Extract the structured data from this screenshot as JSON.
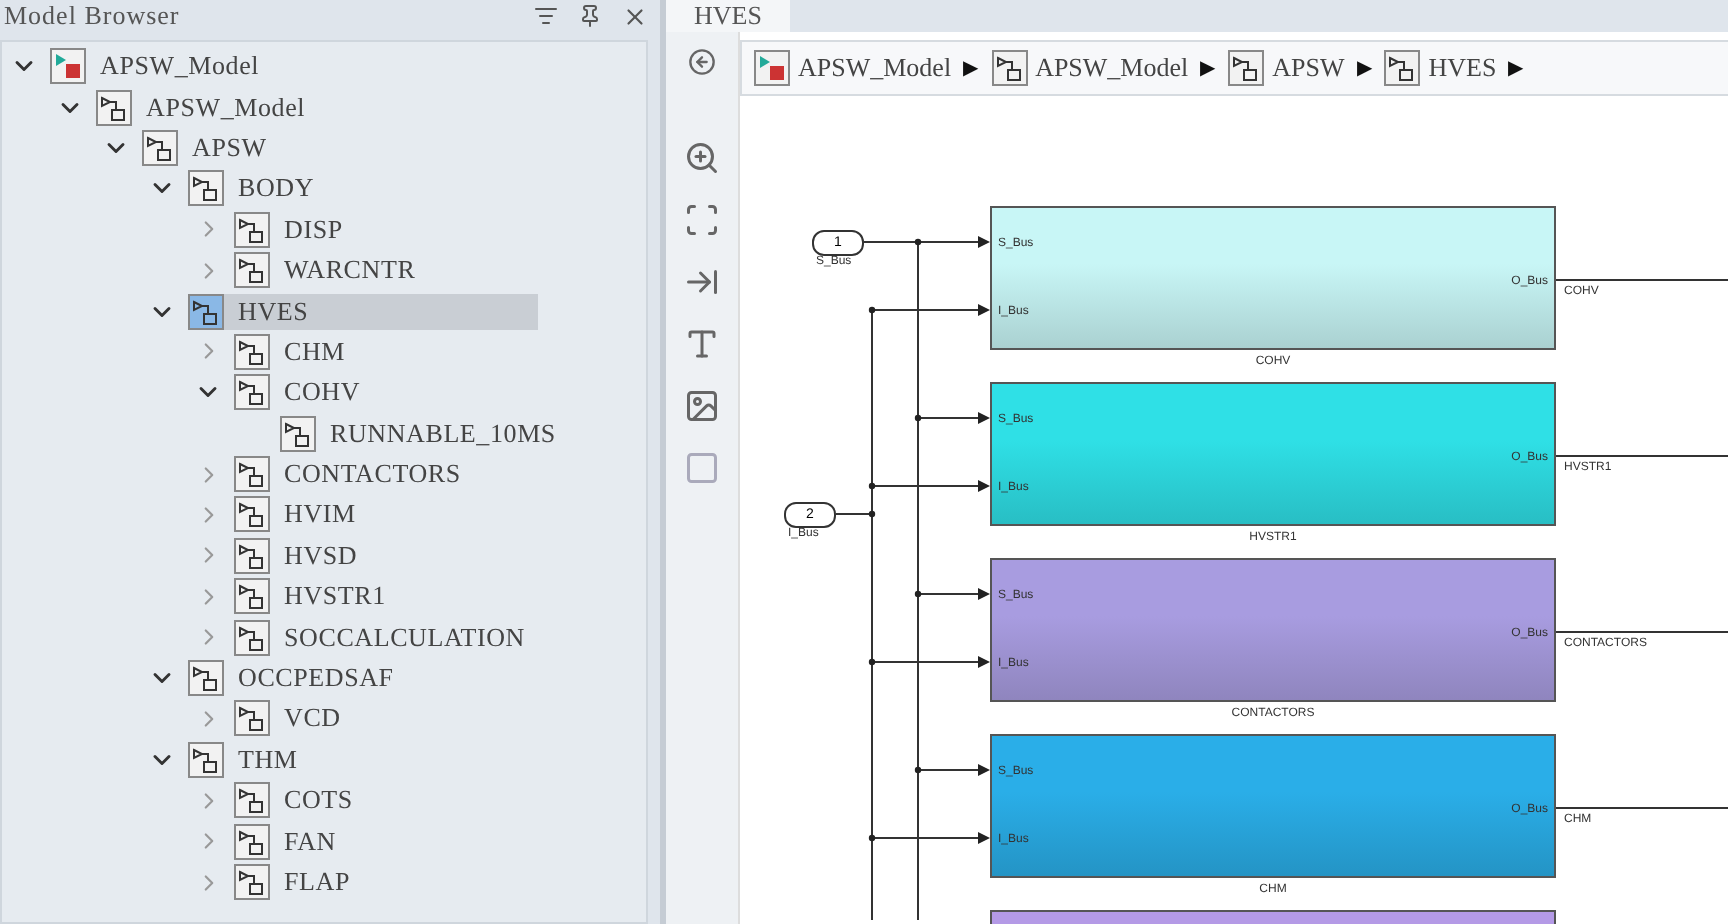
{
  "browser": {
    "title": "Model Browser",
    "tree": [
      {
        "label": "APSW_Model",
        "kind": "model",
        "expanded": true,
        "selected": false,
        "children": [
          {
            "label": "APSW_Model",
            "expanded": true,
            "selected": false,
            "children": [
              {
                "label": "APSW",
                "expanded": true,
                "selected": false,
                "children": [
                  {
                    "label": "BODY",
                    "expanded": true,
                    "selected": false,
                    "children": [
                      {
                        "label": "DISP",
                        "expanded": false,
                        "selected": false
                      },
                      {
                        "label": "WARCNTR",
                        "expanded": false,
                        "selected": false
                      }
                    ]
                  },
                  {
                    "label": "HVES",
                    "expanded": true,
                    "selected": true,
                    "children": [
                      {
                        "label": "CHM",
                        "expanded": false,
                        "selected": false
                      },
                      {
                        "label": "COHV",
                        "expanded": true,
                        "selected": false,
                        "children": [
                          {
                            "label": "RUNNABLE_10MS",
                            "kind": "leaf",
                            "expanded": false,
                            "selected": false
                          }
                        ]
                      },
                      {
                        "label": "CONTACTORS",
                        "expanded": false,
                        "selected": false
                      },
                      {
                        "label": "HVIM",
                        "expanded": false,
                        "selected": false
                      },
                      {
                        "label": "HVSD",
                        "expanded": false,
                        "selected": false
                      },
                      {
                        "label": "HVSTR1",
                        "expanded": false,
                        "selected": false
                      },
                      {
                        "label": "SOCCALCULATION",
                        "expanded": false,
                        "selected": false
                      }
                    ]
                  },
                  {
                    "label": "OCCPEDSAF",
                    "expanded": true,
                    "selected": false,
                    "children": [
                      {
                        "label": "VCD",
                        "expanded": false,
                        "selected": false
                      }
                    ]
                  },
                  {
                    "label": "THM",
                    "expanded": true,
                    "selected": false,
                    "children": [
                      {
                        "label": "COTS",
                        "expanded": false,
                        "selected": false
                      },
                      {
                        "label": "FAN",
                        "expanded": false,
                        "selected": false
                      },
                      {
                        "label": "FLAP",
                        "expanded": false,
                        "selected": false
                      }
                    ]
                  }
                ]
              }
            ]
          }
        ]
      }
    ]
  },
  "editor": {
    "tab": {
      "label": "HVES",
      "selected": true
    },
    "breadcrumb": [
      {
        "label": "APSW_Model",
        "kind": "model"
      },
      {
        "label": "APSW_Model",
        "kind": "subsystem"
      },
      {
        "label": "APSW",
        "kind": "subsystem"
      },
      {
        "label": "HVES",
        "kind": "subsystem"
      }
    ],
    "separator": "▶",
    "inports": [
      {
        "number": "1",
        "label": "S_Bus"
      },
      {
        "number": "2",
        "label": "I_Bus"
      }
    ],
    "blocks": [
      {
        "name": "COHV",
        "color": "#c8f6f6",
        "inputs": [
          "S_Bus",
          "I_Bus"
        ],
        "output": "O_Bus",
        "output_label": "COHV"
      },
      {
        "name": "HVSTR1",
        "color": "#2fe0e6",
        "inputs": [
          "S_Bus",
          "I_Bus"
        ],
        "output": "O_Bus",
        "output_label": "HVSTR1"
      },
      {
        "name": "CONTACTORS",
        "color": "#a89ce0",
        "inputs": [
          "S_Bus",
          "I_Bus"
        ],
        "output": "O_Bus",
        "output_label": "CONTACTORS"
      },
      {
        "name": "CHM",
        "color": "#2aaee8",
        "inputs": [
          "S_Bus",
          "I_Bus"
        ],
        "output": "O_Bus",
        "output_label": "CHM"
      },
      {
        "color": "#b49ae6"
      }
    ]
  }
}
